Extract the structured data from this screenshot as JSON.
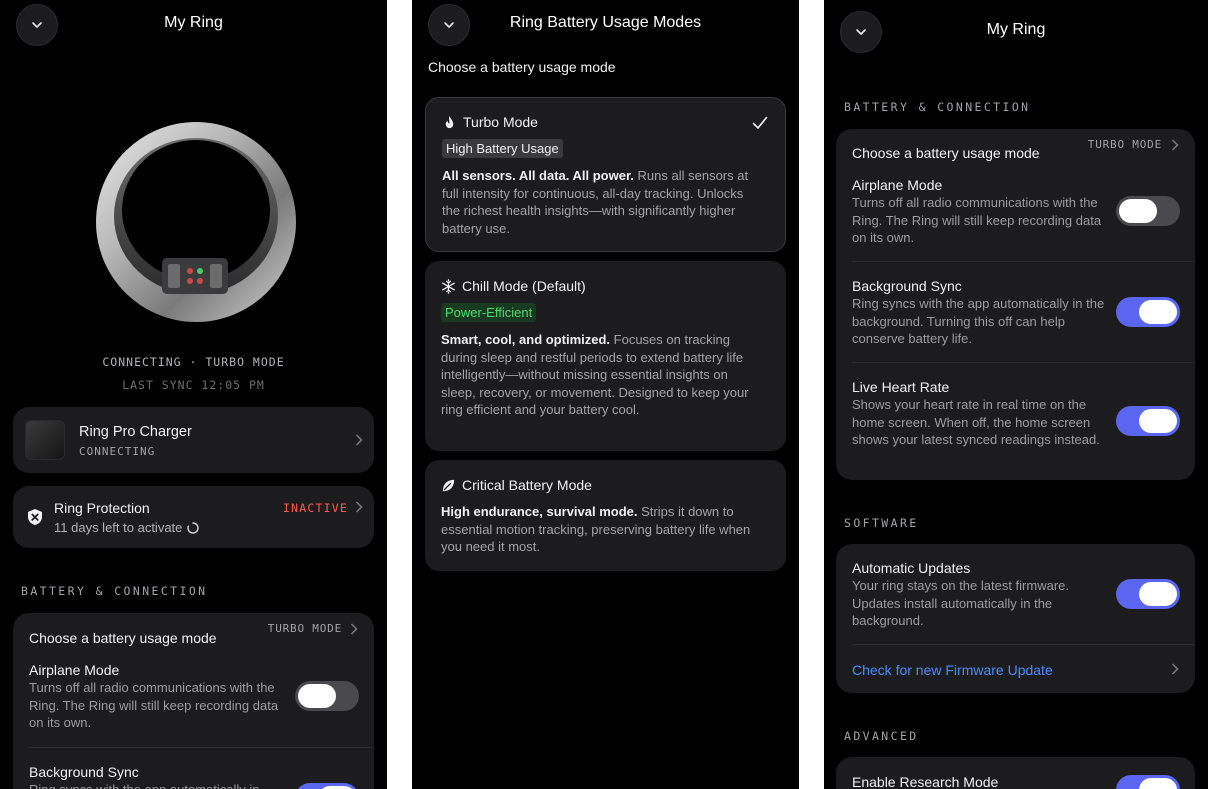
{
  "colors": {
    "accent_toggle": "#5a66ef",
    "inactive_red": "#ff5a4f",
    "link_blue": "#4a8cff",
    "power_green": "#4ade6b"
  },
  "screen1": {
    "title": "My Ring",
    "status_line": "CONNECTING · TURBO MODE",
    "last_sync": "LAST SYNC 12:05 PM",
    "charger": {
      "name": "Ring Pro Charger",
      "status": "CONNECTING"
    },
    "protection": {
      "title": "Ring Protection",
      "subtitle": "11 days left to activate",
      "status": "INACTIVE"
    },
    "section_battery": "BATTERY & CONNECTION",
    "battery_mode": {
      "label": "Choose a battery usage mode",
      "value": "TURBO MODE"
    },
    "airplane": {
      "title": "Airplane Mode",
      "desc": "Turns off all radio communications with the Ring. The Ring will still keep recording data on its own."
    },
    "background_sync": {
      "title": "Background Sync",
      "desc": "Ring syncs with the app automatically in"
    }
  },
  "screen2": {
    "title": "Ring Battery Usage Modes",
    "subtitle": "Choose a battery usage mode",
    "modes": [
      {
        "icon": "flame-icon",
        "title": "Turbo Mode",
        "tag": "High Battery Usage",
        "lead": "All sensors. All data. All power.",
        "desc": " Runs all sensors at full intensity for continuous, all-day tracking. Unlocks the richest health insights—with significantly higher battery use.",
        "selected": true
      },
      {
        "icon": "snowflake-icon",
        "title": "Chill Mode (Default)",
        "tag": "Power-Efficient",
        "lead": "Smart, cool, and optimized.",
        "desc": " Focuses on tracking during sleep and restful periods to extend battery life intelligently—without missing essential insights on sleep, recovery, or movement. Designed to keep your ring efficient and your battery cool."
      },
      {
        "icon": "leaf-icon",
        "title": "Critical Battery Mode",
        "lead": "High endurance, survival mode.",
        "desc": " Strips it down to essential motion tracking, preserving battery life when you need it most."
      }
    ]
  },
  "screen3": {
    "title": "My Ring",
    "section_battery": "BATTERY & CONNECTION",
    "battery_mode": {
      "label": "Choose a battery usage mode",
      "value": "TURBO MODE"
    },
    "airplane": {
      "title": "Airplane Mode",
      "desc": "Turns off all radio communications with the Ring. The Ring will still keep recording data on its own.",
      "on": false
    },
    "background_sync": {
      "title": "Background Sync",
      "desc": "Ring syncs with the app automatically in the background. Turning this off can help conserve battery life.",
      "on": true
    },
    "live_hr": {
      "title": "Live Heart Rate",
      "desc": "Shows your heart rate in real time on the home screen. When off, the home screen shows your latest synced readings instead.",
      "on": true
    },
    "section_software": "SOFTWARE",
    "auto_updates": {
      "title": "Automatic Updates",
      "desc": "Your ring stays on the latest firmware. Updates install automatically in the background.",
      "on": true
    },
    "firmware_link": "Check for new Firmware Update",
    "section_advanced": "ADVANCED",
    "research": {
      "title": "Enable Research Mode",
      "on": true
    }
  }
}
